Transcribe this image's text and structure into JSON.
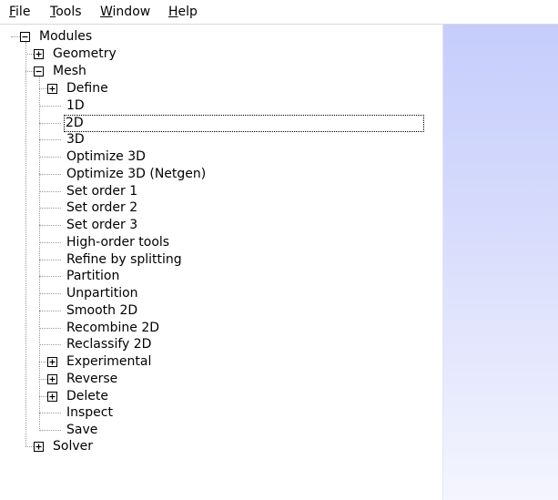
{
  "menubar": {
    "items": [
      {
        "label": "File",
        "accel": "F",
        "rest": "ile"
      },
      {
        "label": "Tools",
        "accel": "T",
        "rest": "ools"
      },
      {
        "label": "Window",
        "accel": "W",
        "rest": "indow"
      },
      {
        "label": "Help",
        "accel": "H",
        "rest": "elp"
      }
    ]
  },
  "tree": {
    "root": {
      "label": "Modules",
      "state": "expanded"
    },
    "geometry": {
      "label": "Geometry",
      "state": "collapsed"
    },
    "mesh": {
      "label": "Mesh",
      "state": "expanded",
      "children": [
        {
          "label": "Define",
          "state": "collapsed"
        },
        {
          "label": "1D"
        },
        {
          "label": "2D",
          "focused": true
        },
        {
          "label": "3D"
        },
        {
          "label": "Optimize 3D"
        },
        {
          "label": "Optimize 3D (Netgen)"
        },
        {
          "label": "Set order 1"
        },
        {
          "label": "Set order 2"
        },
        {
          "label": "Set order 3"
        },
        {
          "label": "High-order tools"
        },
        {
          "label": "Refine by splitting"
        },
        {
          "label": "Partition"
        },
        {
          "label": "Unpartition"
        },
        {
          "label": "Smooth 2D"
        },
        {
          "label": "Recombine 2D"
        },
        {
          "label": "Reclassify 2D"
        },
        {
          "label": "Experimental",
          "state": "collapsed"
        },
        {
          "label": "Reverse",
          "state": "collapsed"
        },
        {
          "label": "Delete",
          "state": "collapsed"
        },
        {
          "label": "Inspect"
        },
        {
          "label": "Save"
        }
      ]
    },
    "solver": {
      "label": "Solver",
      "state": "collapsed"
    }
  },
  "colors": {
    "panel_gradient_top": "#c5cdfb",
    "panel_gradient_bottom": "#f4f5fe",
    "tree_line": "#9a9a9a"
  }
}
